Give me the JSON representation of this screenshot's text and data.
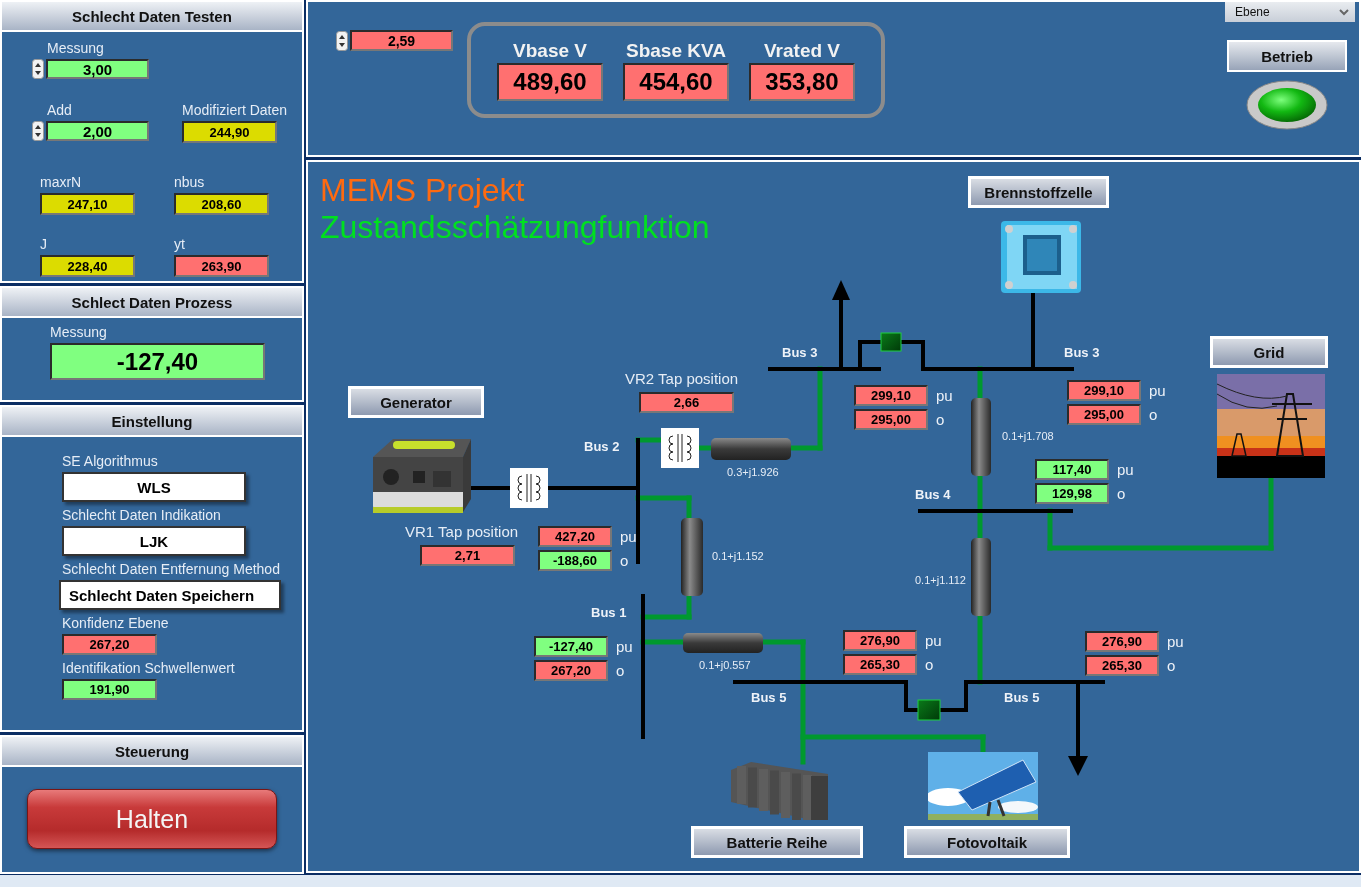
{
  "test_panel": {
    "title": "Schlecht Daten Testen",
    "controls": [
      {
        "label": "Messung",
        "value": "3,00",
        "color": "#80ff80"
      },
      {
        "label": "Add",
        "value": "2,00",
        "color": "#80ff80"
      }
    ],
    "modified": {
      "label": "Modifiziert Daten",
      "value": "244,90",
      "color": "#dcdc00"
    },
    "indicators": [
      {
        "label": "maxrN",
        "value": "247,10",
        "color": "#dcdc00"
      },
      {
        "label": "nbus",
        "value": "208,60",
        "color": "#dcdc00"
      },
      {
        "label": "J",
        "value": "228,40",
        "color": "#dcdc00"
      },
      {
        "label": "yt",
        "value": "263,90",
        "color": "#ff7070"
      }
    ]
  },
  "process_panel": {
    "title": "Schlect Daten Prozess",
    "label": "Messung",
    "value": "-127,40",
    "color": "#80ff80"
  },
  "settings_panel": {
    "title": "Einstellung",
    "items": [
      {
        "kind": "select",
        "label": "SE Algorithmus",
        "value": "WLS"
      },
      {
        "kind": "select",
        "label": "Schlecht Daten Indikation",
        "value": "LJK"
      },
      {
        "kind": "select",
        "label": "Schlecht Daten Entfernung Method",
        "value": "Schlecht Daten Speichern"
      },
      {
        "kind": "indicator",
        "label": "Konfidenz Ebene",
        "value": "267,20",
        "color": "#ff7070"
      },
      {
        "kind": "indicator",
        "label": "Identifikation Schwellenwert",
        "value": "191,90",
        "color": "#80ff80"
      }
    ]
  },
  "control_panel": {
    "title": "Steuerung",
    "button": "Halten"
  },
  "header": {
    "spinner": {
      "value": "2,59",
      "color": "#ff7070"
    },
    "base_values": [
      {
        "label": "Vbase V",
        "value": "489,60",
        "color": "#ff7070"
      },
      {
        "label": "Sbase KVA",
        "value": "454,60",
        "color": "#ff7070"
      },
      {
        "label": "Vrated V",
        "value": "353,80",
        "color": "#ff7070"
      }
    ],
    "dropdown": "Ebene",
    "mode_button": "Betrieb",
    "lamp_on": true
  },
  "diagram": {
    "title": "MEMS Projekt",
    "subtitle": "Zustandsschätzungfunktion",
    "nodes": [
      {
        "label": "Generator",
        "kind": "generator"
      },
      {
        "label": "Brennstoffzelle",
        "kind": "fuelcell"
      },
      {
        "label": "Grid",
        "kind": "grid"
      },
      {
        "label": "Batterie Reihe",
        "kind": "battery"
      },
      {
        "label": "Fotovoltaik",
        "kind": "solar"
      }
    ],
    "bus_labels": [
      "Bus 3",
      "Bus 3",
      "Bus 2",
      "Bus 4",
      "Bus 1",
      "Bus 5",
      "Bus 5"
    ],
    "impedances": [
      "0.3+j1.926",
      "0.1+j1.708",
      "0.1+j1.152",
      "0.1+j1.112",
      "0.1+j0.557"
    ],
    "taps": [
      {
        "label": "VR2 Tap position",
        "value": "2,66",
        "color": "#ff7070"
      },
      {
        "label": "VR1 Tap position",
        "value": "2,71",
        "color": "#ff7070"
      }
    ],
    "readings": [
      [
        {
          "value": "427,20",
          "unit": "pu",
          "color": "#ff7070"
        },
        {
          "value": "-188,60",
          "unit": "o",
          "color": "#80ff80"
        }
      ],
      [
        {
          "value": "299,10",
          "unit": "pu",
          "color": "#ff7070"
        },
        {
          "value": "295,00",
          "unit": "o",
          "color": "#ff7070"
        }
      ],
      [
        {
          "value": "299,10",
          "unit": "pu",
          "color": "#ff7070"
        },
        {
          "value": "295,00",
          "unit": "o",
          "color": "#ff7070"
        }
      ],
      [
        {
          "value": "117,40",
          "unit": "pu",
          "color": "#80ff80"
        },
        {
          "value": "129,98",
          "unit": "o",
          "color": "#80ff80"
        }
      ],
      [
        {
          "value": "-127,40",
          "unit": "pu",
          "color": "#80ff80"
        },
        {
          "value": "267,20",
          "unit": "o",
          "color": "#ff7070"
        }
      ],
      [
        {
          "value": "276,90",
          "unit": "pu",
          "color": "#ff7070"
        },
        {
          "value": "265,30",
          "unit": "o",
          "color": "#ff7070"
        }
      ],
      [
        {
          "value": "276,90",
          "unit": "pu",
          "color": "#ff7070"
        },
        {
          "value": "265,30",
          "unit": "o",
          "color": "#ff7070"
        }
      ]
    ]
  }
}
